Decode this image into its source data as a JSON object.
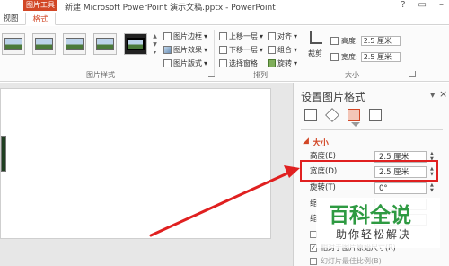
{
  "title_bar": {
    "context_tab": "图片工具",
    "doc_title": "新建 Microsoft PowerPoint 演示文稿.pptx - PowerPoint",
    "help": "?",
    "restore": "▭",
    "minimize": "–"
  },
  "ribbon_tabs": {
    "view": "视图",
    "format": "格式"
  },
  "ribbon": {
    "picture_border": "图片边框",
    "picture_effects": "图片效果",
    "picture_layout": "图片版式",
    "picture_styles_label": "图片样式",
    "bring_forward": "上移一层",
    "send_backward": "下移一层",
    "selection_pane": "选择窗格",
    "align": "对齐",
    "group": "组合",
    "rotate": "旋转",
    "arrange_label": "排列",
    "crop": "裁剪",
    "height_label": "高度:",
    "height_value": "2.5 厘米",
    "width_label": "宽度:",
    "width_value": "2.5 厘米",
    "size_label": "大小"
  },
  "format_pane": {
    "title": "设置图片格式",
    "close": "×",
    "section": "大小",
    "height_label": "高度(E)",
    "height_value": "2.5 厘米",
    "width_label": "宽度(D)",
    "width_value": "2.5 厘米",
    "rotation_label": "旋转(T)",
    "rotation_value": "0°",
    "scale_height_label": "缩",
    "scale_width_label": "缩",
    "relative_original": "相对于图片原始尺寸(R)",
    "best_scale": "幻灯片最佳比例(B)"
  },
  "watermark": {
    "main": "百科全说",
    "sub": "助你轻松解决"
  }
}
